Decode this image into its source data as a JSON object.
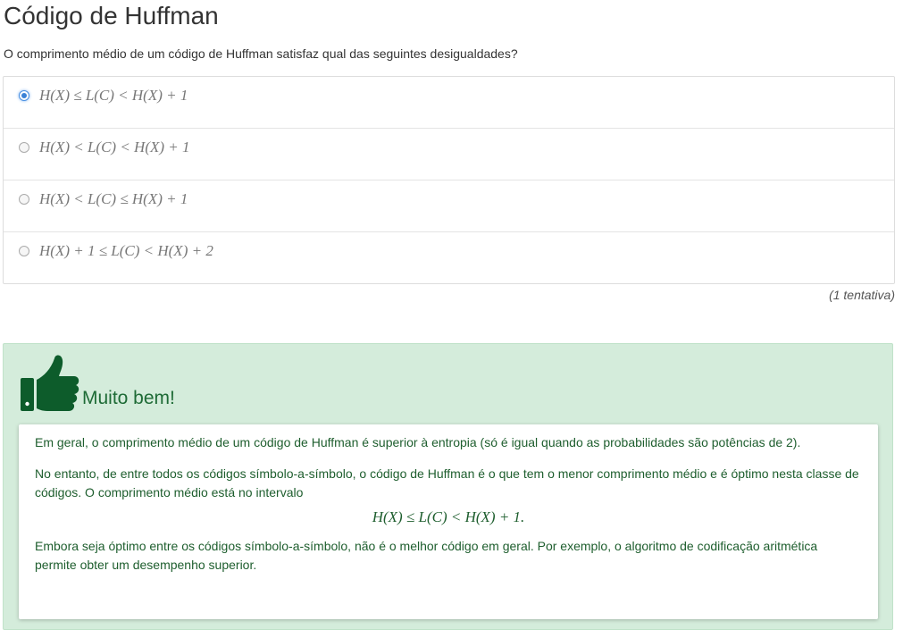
{
  "page": {
    "title": "Código de Huffman",
    "question": "O comprimento médio de um código de Huffman satisfaz qual das seguintes desigualdades?"
  },
  "options": [
    {
      "label": "H(X) ≤ L(C) < H(X) + 1",
      "selected": true
    },
    {
      "label": "H(X) < L(C) < H(X) + 1",
      "selected": false
    },
    {
      "label": "H(X) < L(C) ≤ H(X) + 1",
      "selected": false
    },
    {
      "label": "H(X) + 1 ≤ L(C) < H(X) + 2",
      "selected": false
    }
  ],
  "attempt_text": "(1 tentativa)",
  "feedback": {
    "icon": "thumbs-up-icon",
    "title": "Muito bem!",
    "paragraph1": "Em geral, o comprimento médio de um código de Huffman é superior à entropia (só é igual quando as probabilidades são potências de 2).",
    "paragraph2": "No entanto, de entre todos os códigos símbolo-a-símbolo, o código de Huffman é o que tem o menor comprimento médio e é óptimo nesta classe de códigos. O comprimento médio está no intervalo",
    "formula": "H(X) ≤ L(C) < H(X) + 1.",
    "paragraph3": "Embora seja óptimo entre os códigos símbolo-a-símbolo, não é o melhor código em geral. Por exemplo, o algoritmo de codificação aritmética permite obter um desempenho superior."
  },
  "colors": {
    "feedback_bg": "#d4ecdb",
    "feedback_text": "#1e5e2e",
    "thumb": "#0d5c2b",
    "radio_selected": "#3b82d6"
  }
}
